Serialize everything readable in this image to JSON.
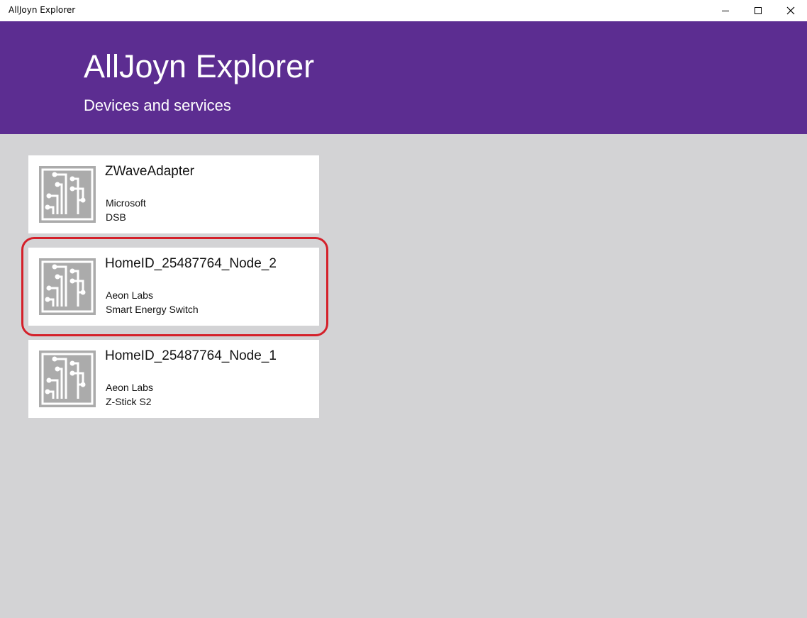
{
  "window": {
    "title": "AllJoyn Explorer"
  },
  "header": {
    "title": "AllJoyn Explorer",
    "subtitle": "Devices and services",
    "background_color": "#5c2d91"
  },
  "devices": [
    {
      "name": "ZWaveAdapter",
      "manufacturer": "Microsoft",
      "model": "DSB",
      "icon": "circuit-board-icon"
    },
    {
      "name": "HomeID_25487764_Node_2",
      "manufacturer": "Aeon Labs",
      "model": "Smart Energy Switch",
      "icon": "circuit-board-icon",
      "highlighted": true
    },
    {
      "name": "HomeID_25487764_Node_1",
      "manufacturer": "Aeon Labs",
      "model": "Z-Stick S2",
      "icon": "circuit-board-icon"
    }
  ],
  "colors": {
    "accent": "#5c2d91",
    "highlight": "#d4202a",
    "background": "#d3d3d5"
  }
}
